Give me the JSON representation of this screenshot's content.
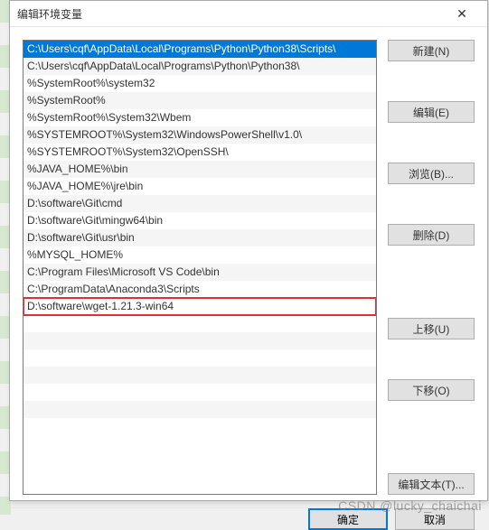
{
  "dialog": {
    "title": "编辑环境变量",
    "close_label": "✕"
  },
  "list": {
    "selected_index": 0,
    "highlighted_index": 14,
    "items": [
      "C:\\Users\\cqf\\AppData\\Local\\Programs\\Python\\Python38\\Scripts\\",
      "C:\\Users\\cqf\\AppData\\Local\\Programs\\Python\\Python38\\",
      "%SystemRoot%\\system32",
      "%SystemRoot%",
      "%SystemRoot%\\System32\\Wbem",
      "%SYSTEMROOT%\\System32\\WindowsPowerShell\\v1.0\\",
      "%SYSTEMROOT%\\System32\\OpenSSH\\",
      "%JAVA_HOME%\\bin",
      "%JAVA_HOME%\\jre\\bin",
      "D:\\software\\Git\\cmd",
      "D:\\software\\Git\\mingw64\\bin",
      "D:\\software\\Git\\usr\\bin",
      "%MYSQL_HOME%",
      "C:\\Program Files\\Microsoft VS Code\\bin",
      "C:\\ProgramData\\Anaconda3\\Scripts",
      "D:\\software\\wget-1.21.3-win64"
    ],
    "blank_rows": 7
  },
  "buttons": {
    "new": "新建(N)",
    "edit": "编辑(E)",
    "browse": "浏览(B)...",
    "delete": "删除(D)",
    "move_up": "上移(U)",
    "move_down": "下移(O)",
    "edit_text": "编辑文本(T)..."
  },
  "footer": {
    "ok": "确定",
    "cancel": "取消"
  },
  "watermark": "CSDN @lucky_chaichai"
}
